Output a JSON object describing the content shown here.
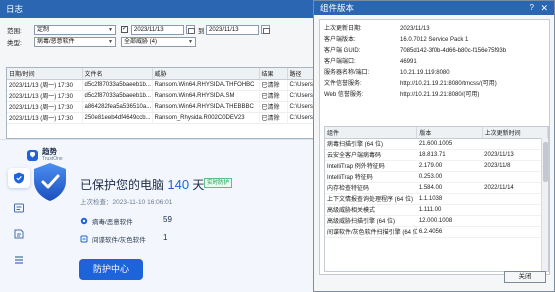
{
  "log": {
    "title": "日志",
    "scope_label": "范围:",
    "scope_value": "定制",
    "type_label": "类型:",
    "type_value": "病毒/恶意软件",
    "date_from": "2023/11/13",
    "date_to": "2023/11/13",
    "to_label": "到",
    "category_value": "全部威胁 (4)",
    "columns": [
      "日期/时间",
      "文件名",
      "威胁",
      "结果",
      "路径"
    ],
    "rows": [
      [
        "2023/11/13 (周一) 17:30",
        "d5c2f87033a5baeeb1b...",
        "Ransom.Win64.RHYSIDA.THFOHBC",
        "已清除",
        "C:\\Users\\"
      ],
      [
        "2023/11/13 (周一) 17:30",
        "d5c2f87033a5baeeb1b...",
        "Ransom.Win64.RHYSIDA.SM",
        "已清除",
        "C:\\Users\\"
      ],
      [
        "2023/11/13 (周一) 17:30",
        "a864282fea5a536510a...",
        "Ransom.Win64.RHYSIDA.THEBBBC",
        "已清除",
        "C:\\Users\\"
      ],
      [
        "2023/11/13 (周一) 17:30",
        "250e81eeb4df4649ccb...",
        "Ransom_Rhysida.R002C0DEV23",
        "已清除",
        "C:\\Users\\"
      ]
    ]
  },
  "app": {
    "brand_name": "趋势",
    "brand_sub": "TrustOne",
    "status_prefix": "已保护您的电脑",
    "days": "140",
    "days_unit": "天",
    "realtime_badge": "实时防护",
    "last_check": "上次检查：2023-11-10 16:06:01",
    "stats": [
      {
        "label": "病毒/恶意软件",
        "value": "59"
      },
      {
        "label": "间谍软件/灰色软件",
        "value": "1"
      }
    ],
    "primary_button": "防护中心"
  },
  "dialog": {
    "title": "组件版本",
    "help": "?",
    "close_x": "✕",
    "info": [
      {
        "label": "上次更新日期:",
        "value": "2023/11/13"
      },
      {
        "label": "客户端版本:",
        "value": "16.0.7012 Service Pack 1"
      },
      {
        "label": "客户端 GUID:",
        "value": "7085d142-3f0b-4d66-b80c-f156e75f93b"
      },
      {
        "label": "客户端端口:",
        "value": "46991"
      },
      {
        "label": "服务器名称/端口:",
        "value": "10.21.19.119:8080"
      },
      {
        "label": "文件信誉服务:",
        "value": "http://10.21.19.21:8080/tmcss/(可用)"
      },
      {
        "label": "Web 信誉服务:",
        "value": "http://10.21.19.21:8080/(可用)"
      }
    ],
    "columns": [
      "组件",
      "版本",
      "上次更新时间"
    ],
    "components": [
      [
        "病毒扫描引擎 (64 位)",
        "21.600.1005",
        ""
      ],
      [
        "云安全客户端病毒码",
        "18.813.71",
        "2023/11/13"
      ],
      [
        "IntelliTrap 例外特征码",
        "2.179.00",
        "2023/11/8"
      ],
      [
        "IntelliTrap 特征码",
        "0.253.00",
        ""
      ],
      [
        "内存检查特征码",
        "1.584.00",
        "2022/11/14"
      ],
      [
        "上下文情报查询处理程序 (64 位)",
        "1.1.1038",
        ""
      ],
      [
        "高级威胁相关模式",
        "1.111.00",
        ""
      ],
      [
        "高级威胁扫描引擎 (64 位)",
        "12.000.1008",
        ""
      ],
      [
        "间谍软件/灰色软件扫描引擎 (64 位)",
        "6.2.4056",
        ""
      ]
    ],
    "close_button": "关闭"
  }
}
